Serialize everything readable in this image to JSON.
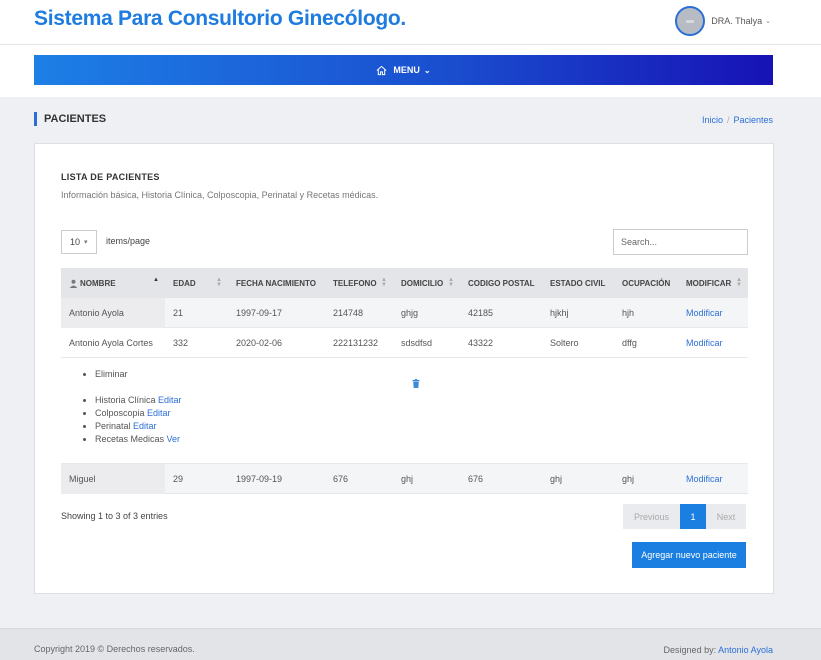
{
  "app": {
    "title": "Sistema Para Consultorio Ginecólogo."
  },
  "user": {
    "name": "DRA. Thalya"
  },
  "menu": {
    "label": "MENU"
  },
  "page": {
    "title": "PACIENTES"
  },
  "breadcrumb": {
    "home": "Inicio",
    "current": "Pacientes"
  },
  "card": {
    "title": "LISTA DE PACIENTES",
    "subtitle": "Información básica, Historia Clínica, Colposcopia, Perinatal y Recetas médicas."
  },
  "table_controls": {
    "page_size": "10",
    "page_size_label": "items/page",
    "search_placeholder": "Search..."
  },
  "table": {
    "headers": [
      "NOMBRE",
      "EDAD",
      "FECHA NACIMIENTO",
      "TELEFONO",
      "DOMICILIO",
      "CODIGO POSTAL",
      "ESTADO CIVIL",
      "OCUPACIÓN",
      "MODIFICAR"
    ],
    "rows": [
      [
        "Antonio Ayola",
        "21",
        "1997-09-17",
        "214748",
        "ghjg",
        "42185",
        "hjkhj",
        "hjh",
        "Modificar"
      ],
      [
        "Antonio Ayola Cortes",
        "332",
        "2020-02-06",
        "222131232",
        "sdsdfsd",
        "43322",
        "Soltero",
        "dffg",
        "Modificar"
      ],
      [
        "Miguel",
        "29",
        "1997-09-19",
        "676",
        "ghj",
        "676",
        "ghj",
        "ghj",
        "Modificar"
      ]
    ],
    "detail": {
      "eliminar": "Eliminar",
      "items": [
        {
          "label": "Historia Clínica",
          "link": "Editar"
        },
        {
          "label": "Colposcopia",
          "link": "Editar"
        },
        {
          "label": "Perinatal",
          "link": "Editar"
        },
        {
          "label": "Recetas Medicas",
          "link": "Ver"
        }
      ]
    }
  },
  "pagination": {
    "showing": "Showing 1 to 3 of 3 entries",
    "previous": "Previous",
    "current": "1",
    "next": "Next"
  },
  "actions": {
    "add_patient": "Agregar nuevo paciente"
  },
  "footer": {
    "copyright": "Copyright 2019 © Derechos reservados.",
    "designed_by": "Designed by:",
    "designer": "Antonio Ayola"
  },
  "colors": {
    "accent": "#1a7fe0",
    "brand": "#1e7be0",
    "menu_gradient_end": "#1712b5"
  }
}
